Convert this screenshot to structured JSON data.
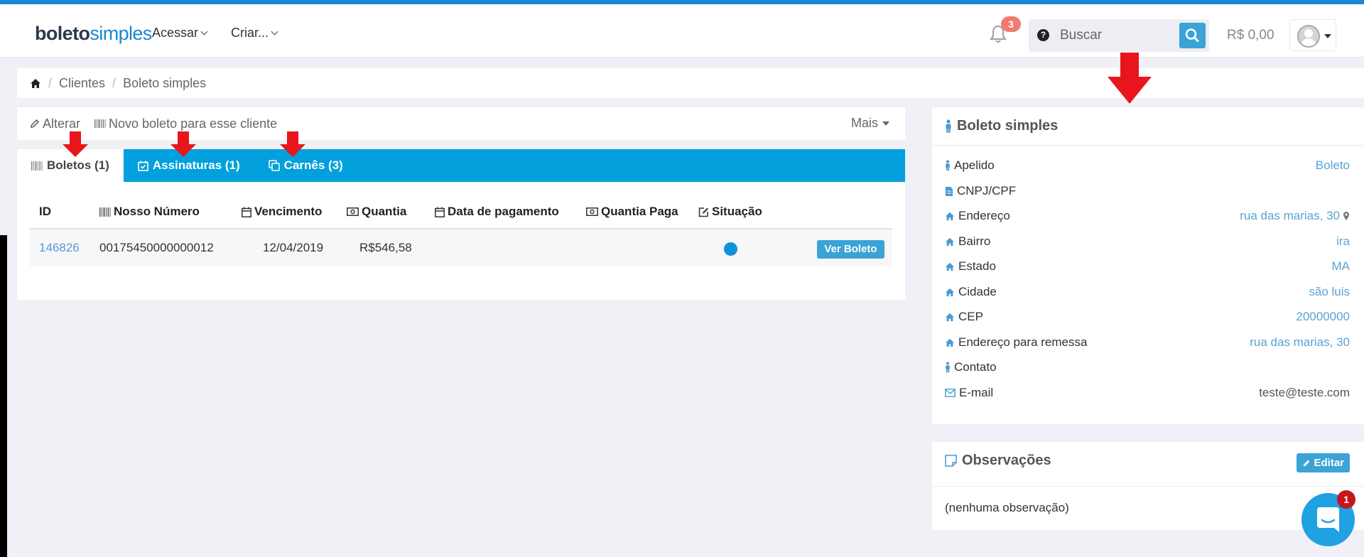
{
  "header": {
    "logo_part1": "boleto",
    "logo_part2": "simples",
    "nav": [
      "Acessar",
      "Criar..."
    ],
    "notification_count": "3",
    "search_placeholder": "Buscar",
    "balance": "R$ 0,00"
  },
  "breadcrumb": [
    "Clientes",
    "Boleto simples"
  ],
  "actions": {
    "edit": "Alterar",
    "new_boleto": "Novo boleto para esse cliente",
    "more": "Mais"
  },
  "tabs": [
    {
      "label": "Boletos (1)",
      "active": true
    },
    {
      "label": "Assinaturas (1)",
      "active": false
    },
    {
      "label": "Carnês (3)",
      "active": false
    }
  ],
  "table": {
    "columns": [
      "ID",
      "Nosso Número",
      "Vencimento",
      "Quantia",
      "Data de pagamento",
      "Quantia Paga",
      "Situação"
    ],
    "rows": [
      {
        "id": "146826",
        "nosso_numero": "00175450000000012",
        "vencimento": "12/04/2019",
        "quantia": "R$546,58",
        "data_pagamento": "",
        "quantia_paga": "",
        "action": "Ver Boleto"
      }
    ]
  },
  "client": {
    "title": "Boleto simples",
    "fields": [
      {
        "label": "Apelido",
        "value": "Boleto"
      },
      {
        "label": "CNPJ/CPF",
        "value": ""
      },
      {
        "label": "Endereço",
        "value": "rua das marias, 30"
      },
      {
        "label": "Bairro",
        "value": "ira"
      },
      {
        "label": "Estado",
        "value": "MA"
      },
      {
        "label": "Cidade",
        "value": "são luis"
      },
      {
        "label": "CEP",
        "value": "20000000"
      },
      {
        "label": "Endereço para remessa",
        "value": "rua das marias, 30"
      },
      {
        "label": "Contato",
        "value": ""
      },
      {
        "label": "E-mail",
        "value": "teste@teste.com"
      }
    ]
  },
  "observacoes": {
    "title": "Observações",
    "edit_label": "Editar",
    "text": "(nenhuma observação)"
  },
  "chat": {
    "badge": "1"
  },
  "colors": {
    "primary": "#02a0dc",
    "button": "#3ba3d6",
    "link": "#5aa3d6",
    "annotation_arrow": "#e8161b"
  }
}
